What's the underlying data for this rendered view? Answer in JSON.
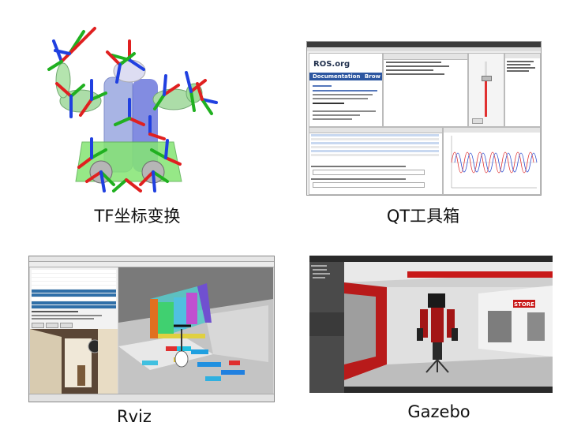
{
  "panels": [
    {
      "id": "tf",
      "caption": "TF坐标变换"
    },
    {
      "id": "qt",
      "caption": "QT工具箱",
      "doc": {
        "logo": "ROS.org",
        "bar_label": "Documentation",
        "bar_right": "Brow"
      }
    },
    {
      "id": "rviz",
      "caption": "Rviz"
    },
    {
      "id": "gazebo",
      "caption": "Gazebo",
      "sign": "STORE"
    }
  ],
  "colors": {
    "axis_x": "#e02020",
    "axis_y": "#20b020",
    "axis_z": "#2040e0",
    "qt_bar": "#2c56a0",
    "rviz_selected": "#2f6fa8",
    "gazebo_robot": "#a31515"
  }
}
